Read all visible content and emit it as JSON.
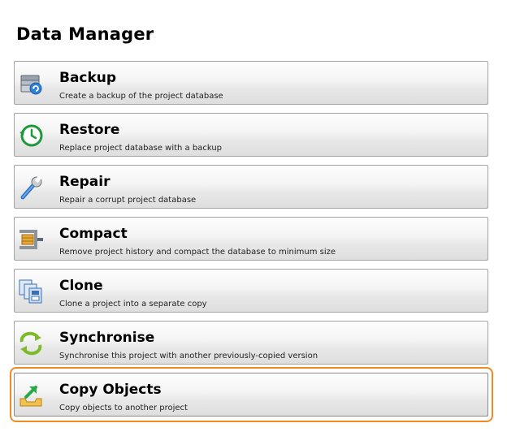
{
  "header": {
    "title": "Data Manager"
  },
  "actions": [
    {
      "label": "Backup",
      "description": "Create a backup of the project database",
      "icon": "database-backup-icon"
    },
    {
      "label": "Restore",
      "description": "Replace project database with a backup",
      "icon": "restore-clock-icon"
    },
    {
      "label": "Repair",
      "description": "Repair a corrupt project database",
      "icon": "wrench-icon"
    },
    {
      "label": "Compact",
      "description": "Remove project history and compact the database to minimum size",
      "icon": "clamp-compact-icon"
    },
    {
      "label": "Clone",
      "description": "Clone a project into a separate copy",
      "icon": "clone-documents-icon"
    },
    {
      "label": "Synchronise",
      "description": "Synchronise this project with another previously-copied version",
      "icon": "sync-arrows-icon"
    },
    {
      "label": "Copy Objects",
      "description": "Copy objects to another project",
      "icon": "copy-to-tray-icon"
    }
  ],
  "colors": {
    "highlight": "#f08a24"
  }
}
